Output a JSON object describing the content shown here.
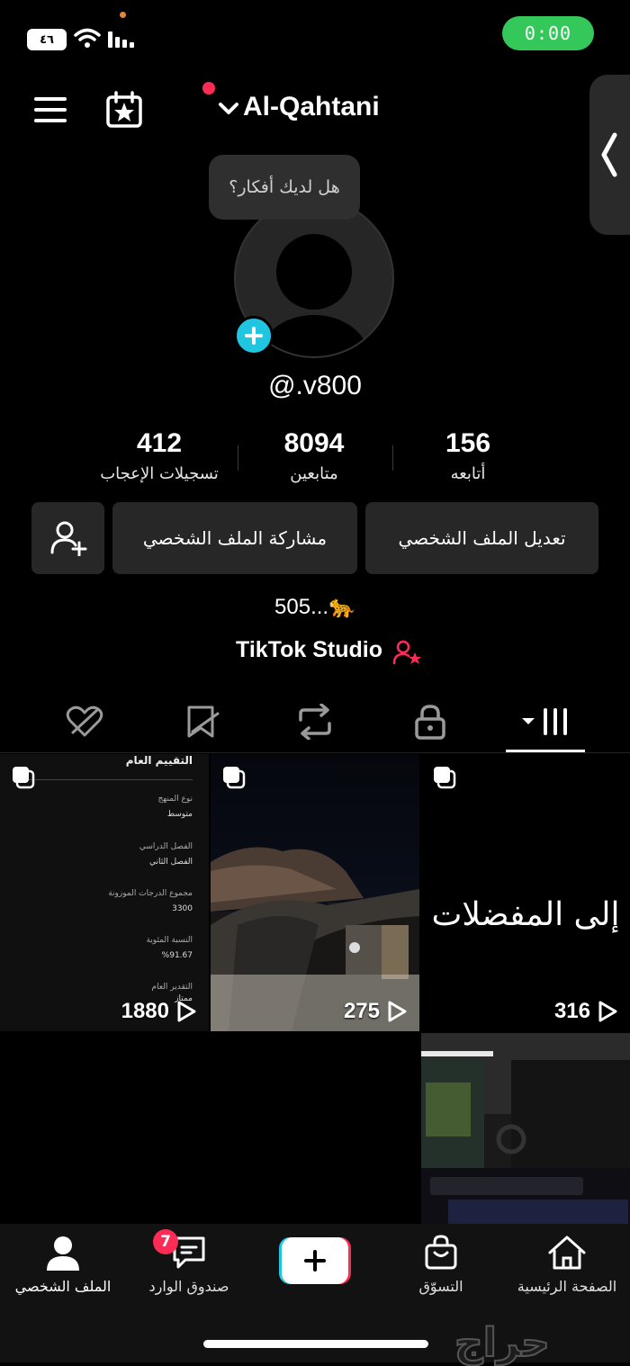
{
  "status_bar": {
    "battery_level": "٤٦",
    "call_time": "0:00"
  },
  "header": {
    "username": "Al-Qahtani"
  },
  "profile": {
    "thought_bubble": "هل لديك أفكار؟",
    "handle": "@.v800",
    "stats": [
      {
        "value": "412",
        "label": "تسجيلات الإعجاب"
      },
      {
        "value": "8094",
        "label": "متابعين"
      },
      {
        "value": "156",
        "label": "أتابعه"
      }
    ],
    "buttons": {
      "share": "مشاركة الملف الشخصي",
      "edit": "تعديل الملف الشخصي"
    },
    "bio": "505...🐆",
    "studio_link": "TikTok Studio"
  },
  "videos": [
    {
      "views": "1880",
      "document": {
        "title": "التقييم العام",
        "rows": [
          {
            "label": "نوع المنهج",
            "value": "متوسط"
          },
          {
            "label": "الفصل الدراسي",
            "value": "الفصل الثاني"
          },
          {
            "label": "مجموع الدرجات الموزونة",
            "value": "3300"
          },
          {
            "label": "النسبة المئوية",
            "value": "%91.67"
          },
          {
            "label": "التقدير العام",
            "value": "ممتاز"
          }
        ]
      }
    },
    {
      "views": "275"
    },
    {
      "views": "316",
      "caption": "إلى المفضلات"
    },
    {
      "views": ""
    }
  ],
  "bottom_nav": [
    {
      "label": "الملف الشخصي"
    },
    {
      "label": "صندوق الوارد",
      "badge": "7"
    },
    {
      "label": ""
    },
    {
      "label": "التسوّق"
    },
    {
      "label": "الصفحة الرئيسية"
    }
  ],
  "watermark": "حراج",
  "colors": {
    "accent_red": "#fe2c55",
    "accent_cyan": "#20c5e0",
    "call_green": "#34c759"
  }
}
